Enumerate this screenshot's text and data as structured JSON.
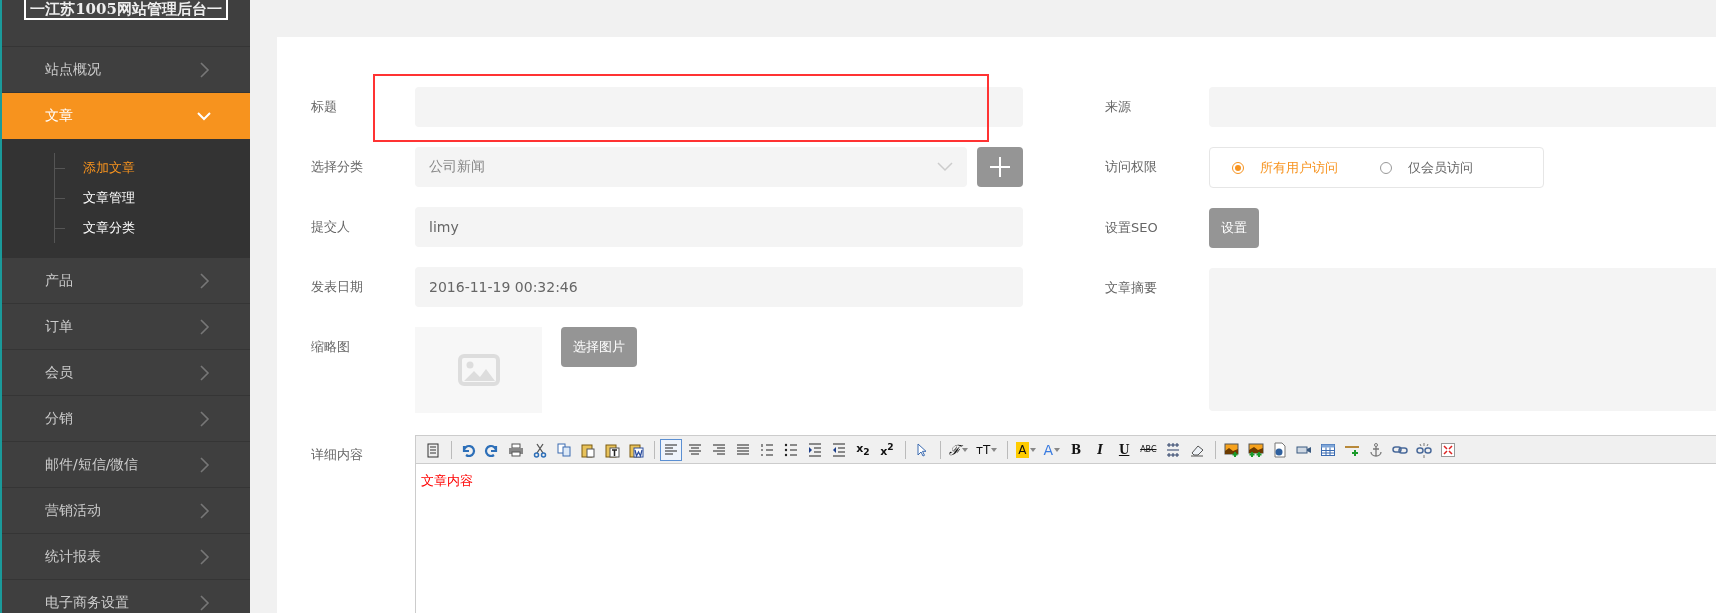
{
  "logo": {
    "text": "一江苏1005网站管理后台一"
  },
  "sidebar": {
    "items": [
      {
        "label": "站点概况",
        "selected": false,
        "expanded": false
      },
      {
        "label": "文章",
        "selected": true,
        "expanded": true,
        "children": [
          {
            "label": "添加文章",
            "selected": true
          },
          {
            "label": "文章管理",
            "selected": false
          },
          {
            "label": "文章分类",
            "selected": false
          }
        ]
      },
      {
        "label": "产品",
        "selected": false,
        "expanded": false
      },
      {
        "label": "订单",
        "selected": false,
        "expanded": false
      },
      {
        "label": "会员",
        "selected": false,
        "expanded": false
      },
      {
        "label": "分销",
        "selected": false,
        "expanded": false
      },
      {
        "label": "邮件/短信/微信",
        "selected": false,
        "expanded": false
      },
      {
        "label": "营销活动",
        "selected": false,
        "expanded": false
      },
      {
        "label": "统计报表",
        "selected": false,
        "expanded": false
      },
      {
        "label": "电子商务设置",
        "selected": false,
        "expanded": false
      }
    ]
  },
  "form": {
    "title": {
      "label": "标题"
    },
    "category": {
      "label": "选择分类",
      "value": "公司新闻"
    },
    "submitter": {
      "label": "提交人",
      "value": "limy"
    },
    "publish_date": {
      "label": "发表日期",
      "value": "2016-11-19 00:32:46"
    },
    "thumbnail": {
      "label": "缩略图",
      "button": "选择图片"
    },
    "source": {
      "label": "来源"
    },
    "access": {
      "label": "访问权限",
      "options": [
        {
          "label": "所有用户访问",
          "selected": true
        },
        {
          "label": "仅会员访问",
          "selected": false
        }
      ]
    },
    "seo": {
      "label": "设置SEO",
      "button": "设置"
    },
    "summary": {
      "label": "文章摘要"
    },
    "content": {
      "label": "详细内容",
      "value": "文章内容",
      "toolbar": [
        [
          {
            "kind": "source",
            "selected": false
          }
        ],
        [
          {
            "kind": "undo",
            "selected": false
          },
          {
            "kind": "redo",
            "selected": false
          },
          {
            "kind": "print",
            "selected": false
          },
          {
            "kind": "cut",
            "selected": false
          },
          {
            "kind": "copy",
            "selected": false
          },
          {
            "kind": "paste",
            "selected": false
          },
          {
            "kind": "paste-text",
            "selected": false
          },
          {
            "kind": "paste-word",
            "selected": false
          }
        ],
        [
          {
            "kind": "align-left",
            "selected": true
          },
          {
            "kind": "align-center",
            "selected": false
          },
          {
            "kind": "align-right",
            "selected": false
          },
          {
            "kind": "justify",
            "selected": false
          },
          {
            "kind": "ordered-list",
            "selected": false
          },
          {
            "kind": "unordered-list",
            "selected": false
          },
          {
            "kind": "indent",
            "selected": false
          },
          {
            "kind": "outdent",
            "selected": false
          },
          {
            "kind": "subscript",
            "label": "x$_{2}$",
            "selected": false
          },
          {
            "kind": "superscript",
            "label": "x$^{2}$",
            "selected": false
          }
        ],
        [
          {
            "kind": "select",
            "selected": false
          }
        ],
        [
          {
            "kind": "font-family",
            "label": "ℱ",
            "selected": false
          },
          {
            "kind": "font-size",
            "label": "ᴛT",
            "selected": false
          }
        ],
        [
          {
            "kind": "highlight",
            "label": "A",
            "selected": false
          },
          {
            "kind": "font-color",
            "label": "A",
            "selected": false
          },
          {
            "kind": "bold",
            "label": "B",
            "selected": false
          },
          {
            "kind": "italic",
            "label": "I",
            "selected": false
          },
          {
            "kind": "underline",
            "label": "U",
            "selected": false
          },
          {
            "kind": "strikethrough",
            "label": "ABC",
            "selected": false
          },
          {
            "kind": "page-break",
            "selected": false
          },
          {
            "kind": "eraser",
            "selected": false
          }
        ],
        [
          {
            "kind": "image",
            "selected": false
          },
          {
            "kind": "multi-image",
            "selected": false
          },
          {
            "kind": "flash",
            "selected": false
          },
          {
            "kind": "video",
            "selected": false
          },
          {
            "kind": "table",
            "selected": false
          },
          {
            "kind": "hr",
            "selected": false
          },
          {
            "kind": "anchor",
            "selected": false
          },
          {
            "kind": "link",
            "selected": false
          },
          {
            "kind": "unlink",
            "selected": false
          },
          {
            "kind": "fullscreen",
            "selected": false
          }
        ]
      ]
    }
  }
}
